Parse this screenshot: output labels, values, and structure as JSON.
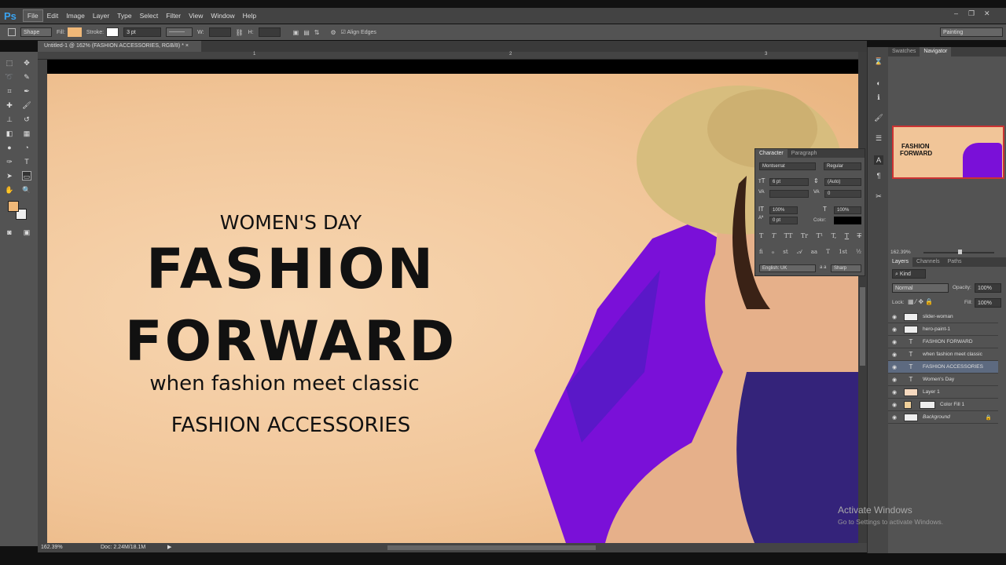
{
  "app": {
    "logo": "Ps"
  },
  "menu": [
    "File",
    "Edit",
    "Image",
    "Layer",
    "Type",
    "Select",
    "Filter",
    "View",
    "Window",
    "Help"
  ],
  "options": {
    "mode": "Shape",
    "fill_label": "Fill:",
    "fill_color": "#f0b878",
    "stroke_label": "Stroke:",
    "stroke_width": "3 pt",
    "w_label": "W:",
    "h_label": "H:",
    "align_edges": "Align Edges",
    "workspace": "Painting"
  },
  "document": {
    "tab_title": "Untitled-1 @ 162% (FASHION ACCESSORIES, RGB/8) *",
    "zoom": "162.39%",
    "doc_size": "Doc: 2.24M/18.1M",
    "ruler_marks": [
      "1",
      "2",
      "3"
    ]
  },
  "artwork": {
    "subtitle": "WOMEN'S DAY",
    "headline1": "FASHION",
    "headline2": "FORWARD",
    "tagline": "when fashion meet classic",
    "accessories": "FASHION ACCESSORIES"
  },
  "navigator": {
    "tabs": [
      "Swatches",
      "Navigator"
    ],
    "thumb_text1": "FASHION",
    "thumb_text2": "FORWARD",
    "zoom": "162.39%"
  },
  "character": {
    "tabs": [
      "Character",
      "Paragraph"
    ],
    "font": "Montserrat",
    "style": "Regular",
    "size": "6 pt",
    "leading": "(Auto)",
    "kerning": "",
    "tracking": "0",
    "vscale": "100%",
    "hscale": "100%",
    "baseline": "0 pt",
    "color_label": "Color:",
    "language": "English: UK",
    "aa_label": "a a",
    "antialias": "Sharp",
    "style_buttons": [
      "T",
      "T",
      "TT",
      "Tr",
      "T¹",
      "T,",
      "T",
      "T"
    ],
    "opentype_buttons": [
      "fi",
      "ℴ",
      "st",
      "𝒜",
      "aa",
      "T",
      "1st",
      "½"
    ]
  },
  "layers": {
    "tabs": [
      "Layers",
      "Channels",
      "Paths"
    ],
    "filter": "Kind",
    "blend": "Normal",
    "opacity_label": "Opacity:",
    "opacity": "100%",
    "lock_label": "Lock:",
    "fill_label": "Fill:",
    "fill": "100%",
    "items": [
      {
        "name": "slider-woman",
        "type": "smart"
      },
      {
        "name": "hero-paint-1",
        "type": "smart"
      },
      {
        "name": "FASHION FORWARD",
        "type": "text"
      },
      {
        "name": "when fashion meet classic",
        "type": "text"
      },
      {
        "name": "FASHION ACCESSORIES",
        "type": "text",
        "selected": true
      },
      {
        "name": "Women's Day",
        "type": "text"
      },
      {
        "name": "Layer 1",
        "type": "pixel"
      },
      {
        "name": "Color Fill 1",
        "type": "fill"
      },
      {
        "name": "Background",
        "type": "bg"
      }
    ]
  },
  "watermark": {
    "line1": "Activate Windows",
    "line2": "Go to Settings to activate Windows."
  }
}
